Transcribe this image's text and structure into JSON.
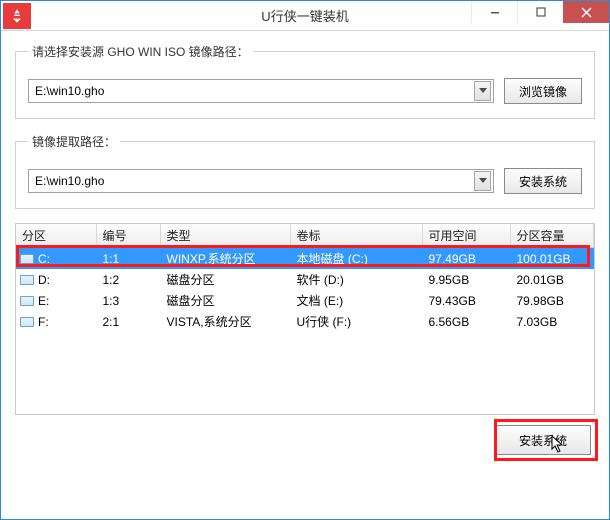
{
  "window": {
    "title": "U行侠一键装机"
  },
  "group_source": {
    "legend": "请选择安装源 GHO WIN ISO 镜像路径：",
    "combo_value": "E:\\win10.gho",
    "browse_label": "浏览镜像"
  },
  "group_extract": {
    "legend": "镜像提取路径：",
    "combo_value": "E:\\win10.gho",
    "install_label": "安装系统"
  },
  "table": {
    "headers": [
      "分区",
      "编号",
      "类型",
      "卷标",
      "可用空间",
      "分区容量"
    ],
    "rows": [
      {
        "drive": "C:",
        "idx": "1:1",
        "type": "WINXP,系统分区",
        "label": "本地磁盘 (C:)",
        "free": "97.49GB",
        "total": "100.01GB",
        "selected": true
      },
      {
        "drive": "D:",
        "idx": "1:2",
        "type": "磁盘分区",
        "label": "软件 (D:)",
        "free": "9.95GB",
        "total": "20.01GB",
        "selected": false
      },
      {
        "drive": "E:",
        "idx": "1:3",
        "type": "磁盘分区",
        "label": "文档 (E:)",
        "free": "79.43GB",
        "total": "79.98GB",
        "selected": false
      },
      {
        "drive": "F:",
        "idx": "2:1",
        "type": "VISTA,系统分区",
        "label": "U行侠 (F:)",
        "free": "6.56GB",
        "total": "7.03GB",
        "selected": false
      }
    ]
  },
  "footer": {
    "install_label": "安装系统"
  }
}
